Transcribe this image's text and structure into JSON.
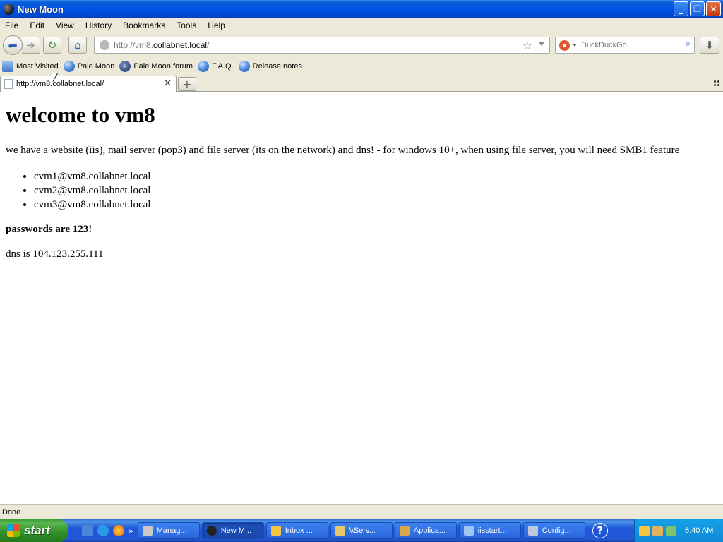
{
  "window": {
    "title": "New Moon"
  },
  "menu": [
    "File",
    "Edit",
    "View",
    "History",
    "Bookmarks",
    "Tools",
    "Help"
  ],
  "navigation": {
    "url_prefix": "http://vm8.",
    "url_domain": "collabnet.local",
    "url_suffix": "/",
    "search_placeholder": "DuckDuckGo"
  },
  "bookmarks": [
    "Most Visited",
    "Pale Moon",
    "Pale Moon forum",
    "F.A.Q.",
    "Release notes"
  ],
  "tab": {
    "title": "http://vm8.collabnet.local/"
  },
  "page": {
    "heading": "welcome to vm8",
    "intro": "we have a website (iis), mail server (pop3) and file server (its on the network) and dns! - for windows 10+, when using file server, you will need SMB1 feature",
    "emails": [
      "cvm1@vm8.collabnet.local",
      "cvm2@vm8.collabnet.local",
      "cvm3@vm8.collabnet.local"
    ],
    "passwords": "passwords are 123!",
    "dns": "dns is 104.123.255.111"
  },
  "status": "Done",
  "taskbar": {
    "start": "start",
    "tasks": [
      "Manag...",
      "New M...",
      "Inbox ...",
      "\\\\Serv...",
      "Applica...",
      "iisstart...",
      "Config..."
    ],
    "clock": "6:40 AM"
  }
}
